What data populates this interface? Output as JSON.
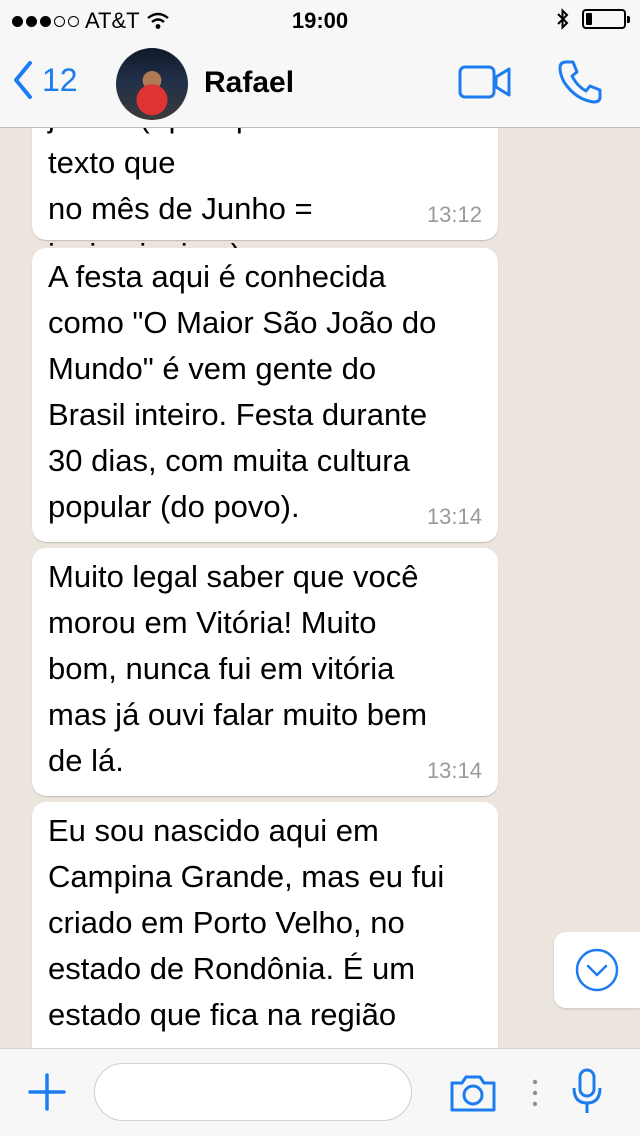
{
  "status_bar": {
    "carrier": "AT&T",
    "signal_bars_filled": 3,
    "signal_bars_total": 5,
    "time": "19:00",
    "battery_level": 0.18
  },
  "header": {
    "back_count": "12",
    "contact_name": "Rafael"
  },
  "messages": [
    {
      "text": "junina ( que aparece em um texto que\nno mês de Junho  =\njunina,junino,)",
      "time": "13:12"
    },
    {
      "text": "A festa aqui é conhecida\ncomo \"O Maior São João do\nMundo\" é vem gente do\nBrasil inteiro. Festa durante\n30 dias, com muita cultura\npopular (do povo).",
      "time": "13:14"
    },
    {
      "text": "Muito legal saber que você\nmorou em Vitória! Muito\nbom, nunca fui em vitória\nmas já ouvi falar muito bem\nde lá.",
      "time": "13:14"
    },
    {
      "text": "Eu sou nascido aqui em\nCampina Grande, mas eu fui\ncriado em Porto Velho, no\nestado de Rondônia. É um\nestado que fica na região\nnorte do Brasil, bem perto",
      "time": ""
    }
  ],
  "input": {
    "value": "",
    "placeholder": ""
  },
  "colors": {
    "accent": "#1C7CF0",
    "chat_background": "#ECE5DD",
    "bubble": "#FFFFFF",
    "timestamp": "#9A9A9A"
  },
  "icons": [
    "chevron-left-icon",
    "video-camera-icon",
    "phone-icon",
    "chevron-down-icon",
    "plus-icon",
    "camera-icon",
    "more-dots-icon",
    "microphone-icon",
    "wifi-icon",
    "bluetooth-icon",
    "battery-icon"
  ]
}
